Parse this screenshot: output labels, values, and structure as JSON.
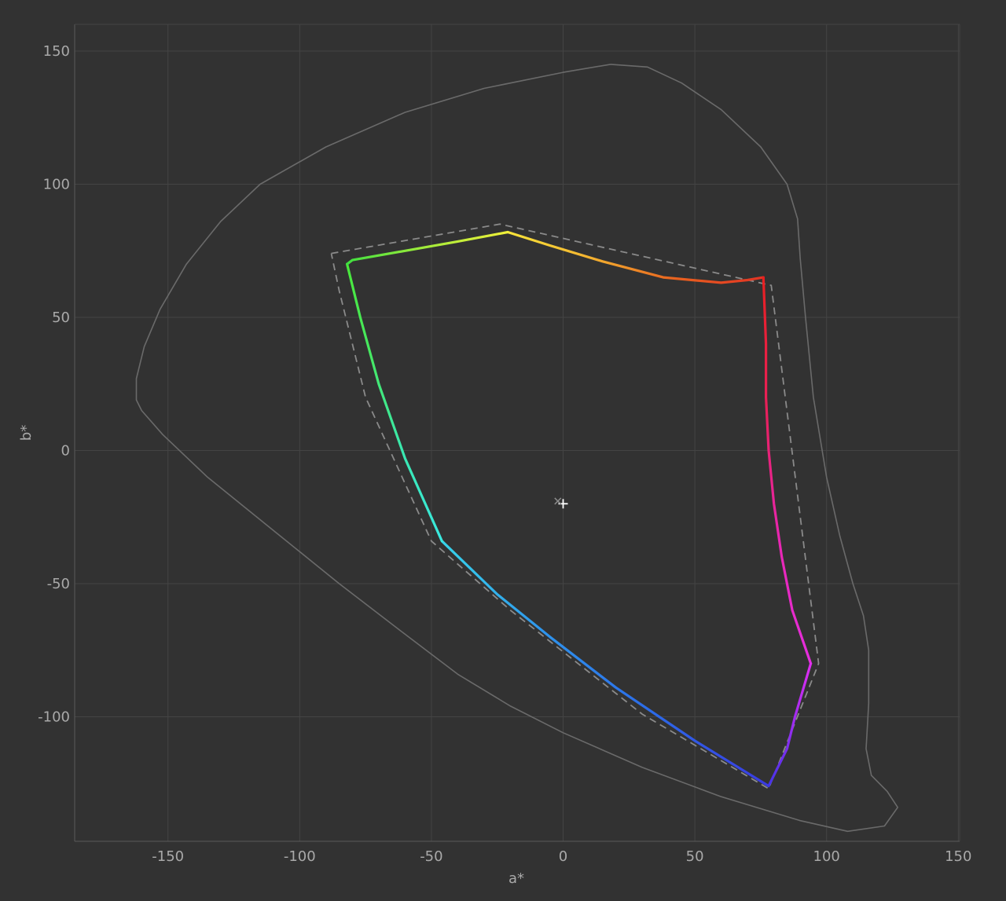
{
  "chart_data": {
    "type": "line",
    "xlabel": "a*",
    "ylabel": "b*",
    "xlim": [
      -187,
      150
    ],
    "ylim": [
      -147,
      160
    ],
    "xticks": [
      -150,
      -100,
      -50,
      0,
      50,
      100,
      150
    ],
    "yticks": [
      150,
      100,
      50,
      0,
      -50,
      -100
    ],
    "grid": true,
    "colors": {
      "background": "#323232",
      "grid": "#444444",
      "axis": "#5a5a5a",
      "boundary": "#6a6a6a",
      "reference": "#8a8a8a",
      "white_point": "#ffffff"
    },
    "series": [
      {
        "role": "visible-boundary",
        "style": "solid-thin",
        "points": [
          [
            18,
            145
          ],
          [
            0,
            142
          ],
          [
            -30,
            136
          ],
          [
            -60,
            127
          ],
          [
            -90,
            114
          ],
          [
            -115,
            100
          ],
          [
            -130,
            86
          ],
          [
            -143,
            70
          ],
          [
            -153,
            53
          ],
          [
            -159,
            39
          ],
          [
            -162,
            27
          ],
          [
            -162,
            19
          ],
          [
            -160,
            15
          ],
          [
            -152,
            6
          ],
          [
            -135,
            -10
          ],
          [
            -110,
            -30
          ],
          [
            -85,
            -50
          ],
          [
            -60,
            -69
          ],
          [
            -40,
            -84
          ],
          [
            -20,
            -96
          ],
          [
            0,
            -106
          ],
          [
            30,
            -119
          ],
          [
            60,
            -130
          ],
          [
            90,
            -139
          ],
          [
            108,
            -143
          ],
          [
            122,
            -141
          ],
          [
            127,
            -134
          ],
          [
            123,
            -128
          ],
          [
            117,
            -122
          ],
          [
            115,
            -112
          ],
          [
            116,
            -95
          ],
          [
            116,
            -75
          ],
          [
            114,
            -62
          ],
          [
            110,
            -50
          ],
          [
            105,
            -32
          ],
          [
            100,
            -10
          ],
          [
            95,
            20
          ],
          [
            92,
            50
          ],
          [
            90,
            72
          ],
          [
            89,
            87
          ],
          [
            85,
            100
          ],
          [
            75,
            114
          ],
          [
            60,
            128
          ],
          [
            45,
            138
          ],
          [
            32,
            144
          ],
          [
            18,
            145
          ]
        ]
      },
      {
        "role": "reference-gamut",
        "style": "dashed",
        "points": [
          [
            -88,
            74
          ],
          [
            -24,
            85
          ],
          [
            79,
            62
          ],
          [
            97,
            -80
          ],
          [
            78,
            -127
          ],
          [
            30,
            -99
          ],
          [
            -20,
            -60
          ],
          [
            -50,
            -34
          ],
          [
            -75,
            20
          ],
          [
            -85,
            60
          ],
          [
            -88,
            74
          ]
        ]
      },
      {
        "role": "measured-gamut",
        "style": "colored",
        "segments": [
          {
            "points": [
              [
                -21,
                82
              ],
              [
                -5,
                77
              ],
              [
                15,
                71
              ],
              [
                38,
                65
              ],
              [
                60,
                63
              ],
              [
                70,
                64
              ],
              [
                76,
                65
              ]
            ],
            "colors": [
              "#f8e43a",
              "#f3b230",
              "#e8621f",
              "#e23424"
            ]
          },
          {
            "points": [
              [
                76,
                65
              ],
              [
                77,
                40
              ],
              [
                77,
                20
              ],
              [
                78,
                0
              ],
              [
                80,
                -20
              ],
              [
                83,
                -40
              ],
              [
                87,
                -60
              ],
              [
                94,
                -80
              ]
            ],
            "colors": [
              "#e82020",
              "#e8205a",
              "#e826b0",
              "#e62ee0"
            ]
          },
          {
            "points": [
              [
                94,
                -80
              ],
              [
                88,
                -100
              ],
              [
                85,
                -112
              ],
              [
                78,
                -126
              ]
            ],
            "colors": [
              "#e02ef0",
              "#9a2cf0",
              "#4434e8"
            ]
          },
          {
            "points": [
              [
                78,
                -126
              ],
              [
                50,
                -109
              ],
              [
                20,
                -89
              ],
              [
                -5,
                -70
              ],
              [
                -25,
                -54
              ],
              [
                -46,
                -34
              ]
            ],
            "colors": [
              "#3a3ae0",
              "#2c6ae8",
              "#2e94ec",
              "#38d4ea"
            ]
          },
          {
            "points": [
              [
                -46,
                -34
              ],
              [
                -60,
                -3
              ],
              [
                -70,
                25
              ],
              [
                -77,
                50
              ],
              [
                -80,
                62
              ],
              [
                -82,
                70
              ]
            ],
            "colors": [
              "#3ae8e0",
              "#3ae8b0",
              "#46e864",
              "#4ae83a"
            ]
          },
          {
            "points": [
              [
                -82,
                70
              ],
              [
                -80,
                71.5
              ],
              [
                -60,
                75
              ],
              [
                -40,
                78.5
              ],
              [
                -21,
                82
              ]
            ],
            "colors": [
              "#40e040",
              "#a4ec3a",
              "#f0f03a"
            ]
          }
        ]
      }
    ],
    "markers": [
      {
        "role": "white-point-measured",
        "symbol": "plus",
        "x": 0,
        "y": -20
      },
      {
        "role": "white-point-reference",
        "symbol": "cross",
        "x": -2,
        "y": -19
      }
    ]
  }
}
